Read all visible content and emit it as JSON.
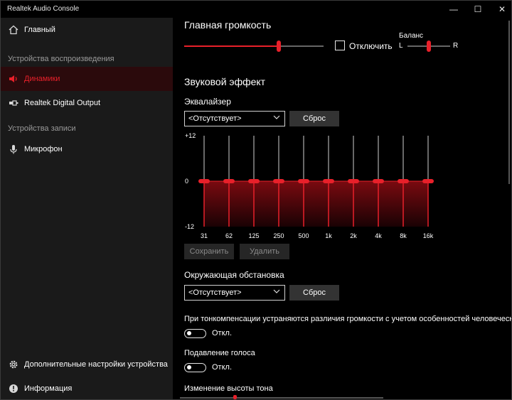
{
  "window": {
    "title": "Realtek Audio Console",
    "minimize": "—",
    "maximize": "☐",
    "close": "✕"
  },
  "sidebar": {
    "home": "Главный",
    "playback_section": "Устройства воспроизведения",
    "speakers": "Динамики",
    "digital_output": "Realtek Digital Output",
    "recording_section": "Устройства записи",
    "microphone": "Микрофон",
    "advanced": "Дополнительные настройки устройства",
    "info": "Информация"
  },
  "main_volume": {
    "title": "Главная громкость",
    "level": 0.68,
    "mute_label": "Отключить",
    "balance_label": "Баланс",
    "balance_left": "L",
    "balance_right": "R",
    "balance": 0.5
  },
  "sound_effect": {
    "title": "Звуковой эффект",
    "equalizer_label": "Эквалайзер",
    "eq_preset": "<Отсутствует>",
    "reset_label": "Сброс",
    "save_label": "Сохранить",
    "delete_label": "Удалить"
  },
  "chart_data": {
    "type": "bar",
    "categories": [
      "31",
      "62",
      "125",
      "250",
      "500",
      "1k",
      "2k",
      "4k",
      "8k",
      "16k"
    ],
    "values": [
      0,
      0,
      0,
      0,
      0,
      0,
      0,
      0,
      0,
      0
    ],
    "y_tick_labels": [
      "+12",
      "0",
      "-12"
    ],
    "ylim": [
      -12,
      12
    ]
  },
  "environment": {
    "title": "Окружающая обстановка",
    "preset": "<Отсутствует>",
    "reset_label": "Сброс"
  },
  "loudness": {
    "description": "При тонкомпенсации устраняются различия громкости с учетом особенностей человеческого",
    "state": "Откл."
  },
  "voice_cancel": {
    "label": "Подавление голоса",
    "state": "Откл."
  },
  "pitch": {
    "label": "Изменение высоты тона"
  },
  "colors": {
    "accent": "#e8202a",
    "sidebar_bg": "#1a1a1a",
    "active_bg": "#2b0a0c"
  }
}
